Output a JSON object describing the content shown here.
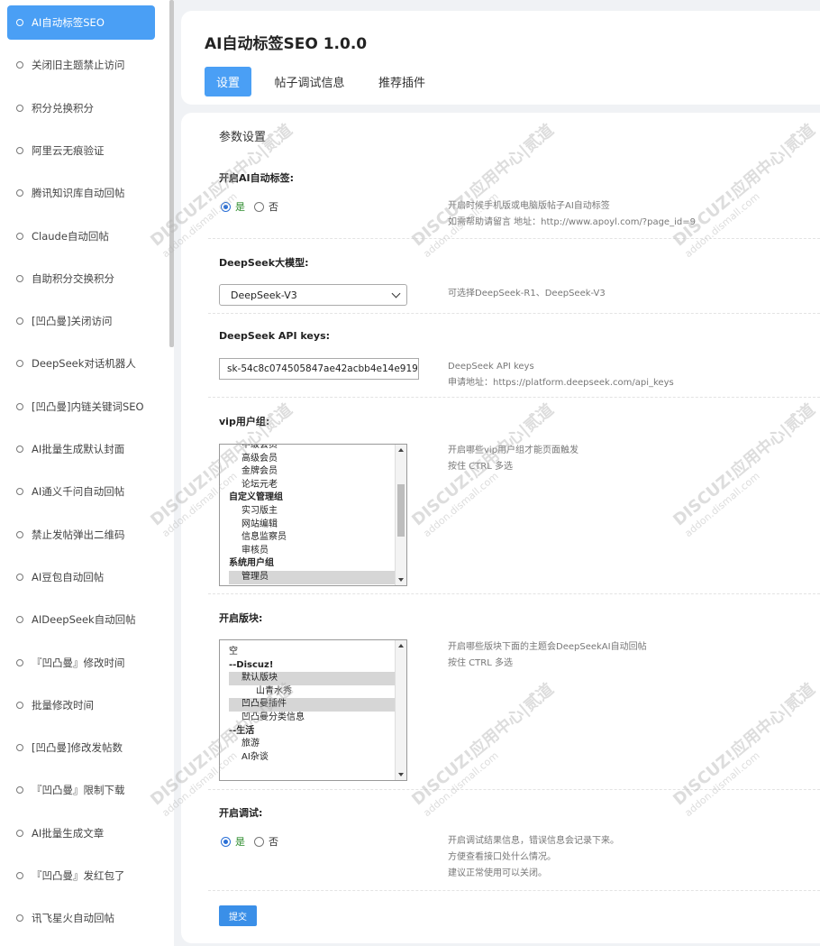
{
  "sidebar": {
    "items": [
      {
        "label": "AI自动标签SEO",
        "active": true
      },
      {
        "label": "关闭旧主题禁止访问"
      },
      {
        "label": "积分兑换积分"
      },
      {
        "label": "阿里云无痕验证"
      },
      {
        "label": "腾讯知识库自动回帖"
      },
      {
        "label": "Claude自动回帖"
      },
      {
        "label": "自助积分交换积分"
      },
      {
        "label": "[凹凸曼]关闭访问"
      },
      {
        "label": "DeepSeek对话机器人"
      },
      {
        "label": "[凹凸曼]内链关键词SEO"
      },
      {
        "label": "AI批量生成默认封面"
      },
      {
        "label": "AI通义千问自动回帖"
      },
      {
        "label": "禁止发帖弹出二维码"
      },
      {
        "label": "AI豆包自动回帖"
      },
      {
        "label": "AIDeepSeek自动回帖"
      },
      {
        "label": "『凹凸曼』修改时间"
      },
      {
        "label": "批量修改时间"
      },
      {
        "label": "[凹凸曼]修改发帖数"
      },
      {
        "label": "『凹凸曼』限制下载"
      },
      {
        "label": "AI批量生成文章"
      },
      {
        "label": "『凹凸曼』发红包了"
      },
      {
        "label": "讯飞星火自动回帖"
      }
    ]
  },
  "header": {
    "title": "AI自动标签SEO 1.0.0",
    "tabs": [
      {
        "label": "设置",
        "active": true
      },
      {
        "label": "帖子调试信息"
      },
      {
        "label": "推荐插件"
      }
    ]
  },
  "main": {
    "section_title": "参数设置",
    "enable_ai": {
      "label": "开启AI自动标签:",
      "yes": "是",
      "no": "否",
      "value": "是",
      "desc1": "开启时候手机版或电脑版帖子AI自动标签",
      "desc2": "如需帮助请留言 地址：http://www.apoyl.com/?page_id=9"
    },
    "model": {
      "label": "DeepSeek大模型:",
      "value": "DeepSeek-V3",
      "desc": "可选择DeepSeek-R1、DeepSeek-V3"
    },
    "api_keys": {
      "label": "DeepSeek API keys:",
      "value": "sk-54c8c074505847ae42acbb4e14e919",
      "desc1": "DeepSeek API keys",
      "desc2": "申请地址：https://platform.deepseek.com/api_keys"
    },
    "vip_groups": {
      "label": "vip用户组:",
      "options": [
        {
          "text": "中级会员"
        },
        {
          "text": "高级会员"
        },
        {
          "text": "金牌会员"
        },
        {
          "text": "论坛元老"
        },
        {
          "text": "自定义管理组",
          "group": true
        },
        {
          "text": "实习版主"
        },
        {
          "text": "网站编辑"
        },
        {
          "text": "信息监察员"
        },
        {
          "text": "审核员"
        },
        {
          "text": "系统用户组",
          "group": true
        },
        {
          "text": "管理员",
          "selected": true
        }
      ],
      "desc1": "开启哪些vip用户组才能页面触发",
      "desc2": "按住 CTRL 多选"
    },
    "forums": {
      "label": "开启版块:",
      "options": [
        {
          "text": "空"
        },
        {
          "text": "--Discuz!",
          "group": true
        },
        {
          "text": "默认版块",
          "selected": true
        },
        {
          "text": "山青水秀"
        },
        {
          "text": "凹凸曼插件",
          "selected": true
        },
        {
          "text": "凹凸曼分类信息"
        },
        {
          "text": "--生活",
          "group": true
        },
        {
          "text": "旅游"
        },
        {
          "text": "AI杂谈"
        }
      ],
      "desc1": "开启哪些版块下面的主题会DeepSeekAI自动回帖",
      "desc2": "按住 CTRL 多选"
    },
    "debug": {
      "label": "开启调试:",
      "yes": "是",
      "no": "否",
      "value": "是",
      "desc1": "开启调试结果信息，错误信息会记录下来。",
      "desc2": "方便查看接口处什么情况。",
      "desc3": "建议正常使用可以关闭。"
    },
    "submit_label": "提交"
  },
  "watermark": {
    "brand": "DISCUZ!应用中心",
    "divider": "|",
    "mark": "贰道",
    "url": "addon.dismall.com"
  },
  "colors": {
    "accent": "#4a9ff5",
    "radio_on": "#2a6fd6",
    "yes_text": "#2a8a2a"
  }
}
